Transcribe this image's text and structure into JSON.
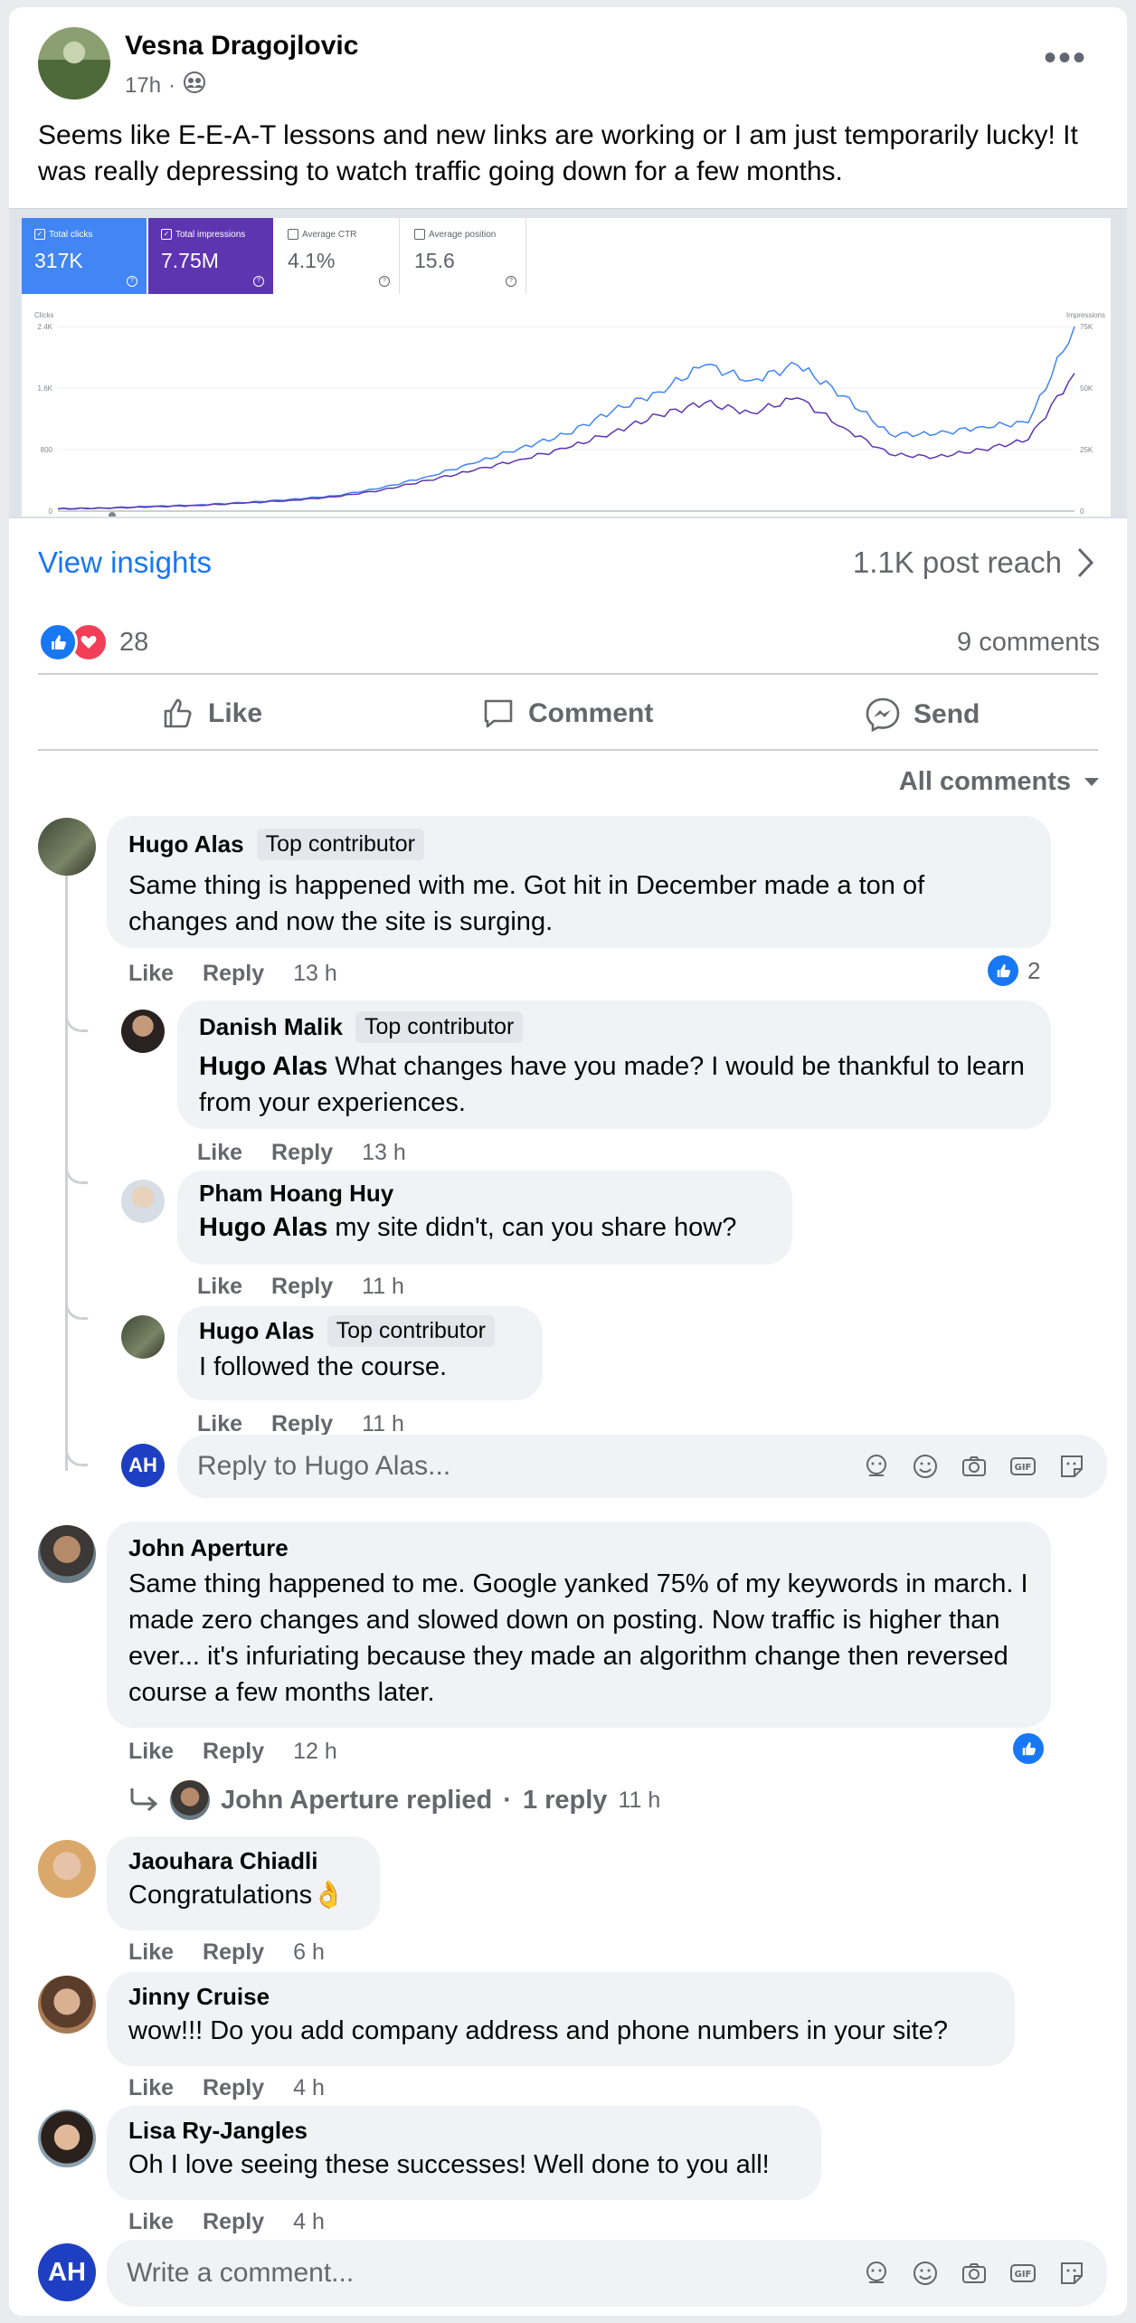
{
  "post": {
    "author": "Vesna Dragojlovic",
    "time": "17h",
    "text": "Seems like E-E-A-T lessons and new links are working or I am just temporarily lucky! It was really depressing to watch traffic going down for a few months."
  },
  "metrics": [
    {
      "label": "Total clicks",
      "value": "317K",
      "color": "#4285f4"
    },
    {
      "label": "Total impressions",
      "value": "7.75M",
      "color": "#5e35b1"
    },
    {
      "label": "Average CTR",
      "value": "4.1%"
    },
    {
      "label": "Average position",
      "value": "15.6"
    }
  ],
  "chart_data": {
    "type": "line",
    "left_axis": {
      "label": "Clicks",
      "ticks": [
        "2.4K",
        "1.6K",
        "800",
        "0"
      ],
      "ylim": [
        0,
        2400
      ]
    },
    "right_axis": {
      "label": "Impressions",
      "ticks": [
        "75K",
        "50K",
        "25K",
        "0"
      ],
      "ylim": [
        0,
        75000
      ]
    },
    "series": [
      {
        "name": "Clicks",
        "color": "#4285f4",
        "values": [
          30,
          40,
          60,
          80,
          110,
          150,
          200,
          300,
          450,
          620,
          820,
          1000,
          1300,
          1550,
          1900,
          1700,
          1900,
          1500,
          1000,
          1000,
          1100,
          1150,
          2400
        ]
      },
      {
        "name": "Impressions",
        "color": "#5e35b1",
        "values": [
          900,
          1200,
          1700,
          2300,
          3200,
          4300,
          5800,
          8500,
          12500,
          16500,
          21000,
          25500,
          32000,
          39000,
          44000,
          40000,
          46000,
          34000,
          23000,
          22000,
          25000,
          29000,
          56000
        ]
      }
    ]
  },
  "insights": {
    "link": "View insights",
    "reach": "1.1K post reach"
  },
  "reactions": {
    "count": "28",
    "comments": "9 comments"
  },
  "actions": {
    "like": "Like",
    "comment": "Comment",
    "send": "Send"
  },
  "filter": "All comments",
  "comments": [
    {
      "name": "Hugo Alas",
      "badge": "Top contributor",
      "text": "Same thing is happened with me. Got hit in December made a ton of changes and now the site is surging.",
      "time": "13 h",
      "likes": "2"
    },
    {
      "name": "Danish Malik",
      "badge": "Top contributor",
      "mention": "Hugo Alas",
      "text": " What changes have you made? I would be thankful to learn from your experiences.",
      "time": "13 h"
    },
    {
      "name": "Pham Hoang Huy",
      "mention": "Hugo Alas",
      "text": " my site didn't, can you share how?",
      "time": "11 h"
    },
    {
      "name": "Hugo Alas",
      "badge": "Top contributor",
      "text": "I followed the course.",
      "time": "11 h"
    },
    {
      "name": "John Aperture",
      "text": "Same thing happened to me. Google yanked 75% of my keywords in march. I made zero changes and slowed down on posting. Now traffic is higher than ever... it's infuriating because they made an algorithm change then reversed course a few months later.",
      "time": "12 h",
      "replied": "John Aperture replied",
      "reply_count": "1 reply",
      "reply_time": "11 h"
    },
    {
      "name": "Jaouhara Chiadli",
      "text": "Congratulations👌",
      "time": "6 h"
    },
    {
      "name": "Jinny Cruise",
      "text": "wow!!! Do you add company address and phone numbers in your site?",
      "time": "4 h"
    },
    {
      "name": "Lisa Ry-Jangles",
      "text": "Oh I love seeing these successes! Well done to you all!",
      "time": "4 h"
    }
  ],
  "comment_actions": {
    "like": "Like",
    "reply": "Reply"
  },
  "reply_placeholder": "Reply to Hugo Alas...",
  "comment_placeholder": "Write a comment...",
  "user_initials": "AH",
  "separator": "·"
}
